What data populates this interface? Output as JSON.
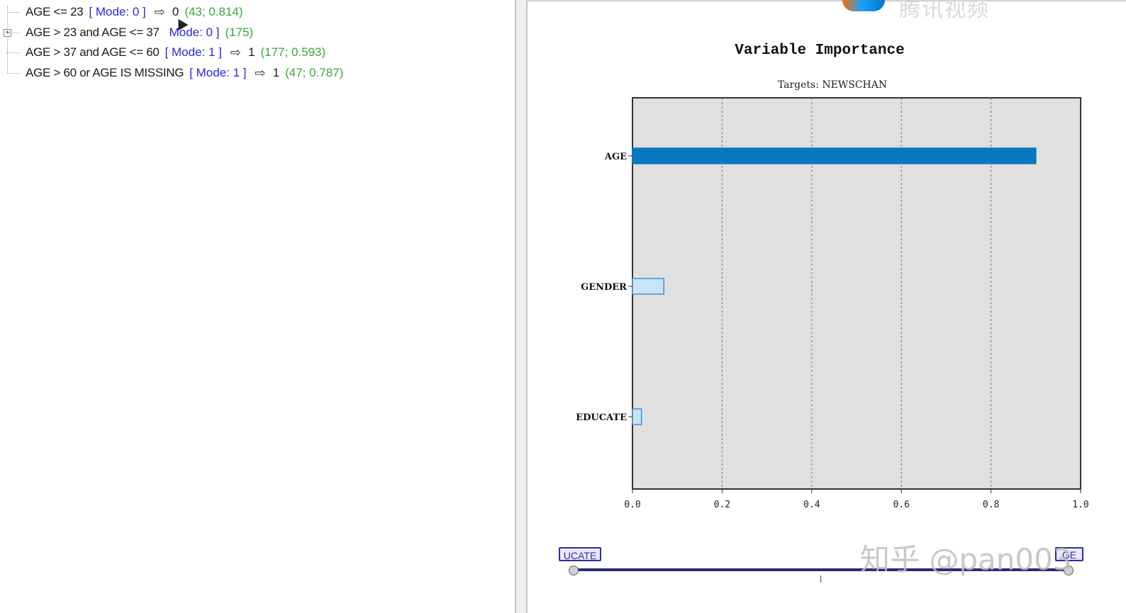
{
  "tree": {
    "rules": [
      {
        "condition": "AGE <= 23",
        "mode": "[ Mode: 0 ]",
        "prediction": "0",
        "stats": "(43; 0.814)"
      },
      {
        "condition": "AGE > 23 and AGE <= 37",
        "mode": "Mode: 0 ]",
        "prediction": "",
        "stats": "(175)",
        "expandable": true
      },
      {
        "condition": "AGE > 37 and AGE <= 60",
        "mode": "[ Mode: 1 ]",
        "prediction": "1",
        "stats": "(177; 0.593)"
      },
      {
        "condition": "AGE > 60 or AGE IS MISSING",
        "mode": "[ Mode: 1 ]",
        "prediction": "1",
        "stats": "(47; 0.787)"
      }
    ],
    "expander_symbol": "+",
    "arrow_icon": "⇨"
  },
  "chart_data": {
    "type": "bar",
    "orientation": "horizontal",
    "title": "Variable Importance",
    "subtitle": "Targets: NEWSCHAN",
    "categories": [
      "AGE",
      "GENDER",
      "EDUCATE"
    ],
    "values": [
      0.9,
      0.07,
      0.02
    ],
    "xlim": [
      0.0,
      1.0
    ],
    "xticks": [
      "0.0",
      "0.2",
      "0.4",
      "0.6",
      "0.8",
      "1.0"
    ],
    "grid": "vertical dashed",
    "plot_background": "#e0e0e0",
    "colors": {
      "highlight": "#0a78c0",
      "other": "#c8e4f8",
      "other_border": "#4a90c8"
    }
  },
  "slider": {
    "left_label": "UCATE",
    "right_label": "GE"
  },
  "branding": {
    "logo_text": "腾讯视频",
    "watermark": "知乎 @pan003"
  }
}
